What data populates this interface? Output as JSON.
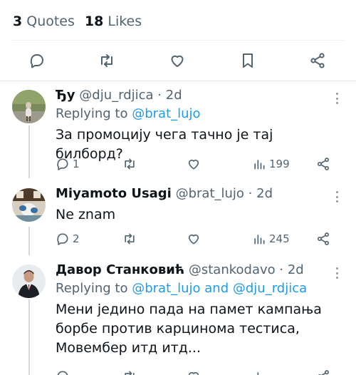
{
  "stats": {
    "quotes_count": "3",
    "quotes_label": "Quotes",
    "likes_count": "18",
    "likes_label": "Likes"
  },
  "actions": [
    "reply-icon",
    "retweet-icon",
    "like-icon",
    "bookmark-icon",
    "share-icon"
  ],
  "replies": [
    {
      "name": "Ђу",
      "handle": "@dju_rdjica",
      "time": "· 2d",
      "replying_prefix": "Replying to",
      "replying_links": "@brat_lujo",
      "text": "За промоцију чега тачно је тај билборд?",
      "reply_count": "1",
      "views": "199"
    },
    {
      "name": "Miyamoto Usagi",
      "handle": "@brat_lujo",
      "time": "· 2d",
      "text": "Ne znam",
      "reply_count": "2",
      "views": "245"
    },
    {
      "name": "Давор Станковић",
      "handle": "@stankodavo",
      "time": "· 2d",
      "replying_prefix": "Replying to",
      "replying_links": "@brat_lujo and @dju_rdjica",
      "text": "Мени једино пада на памет кампања борбе против карцинома тестиса, Мовембер итд итд..."
    }
  ],
  "colors": {
    "link": "#1d9bf0",
    "muted": "#536471",
    "text": "#0f1419",
    "thread_line": "#cfd9de"
  }
}
